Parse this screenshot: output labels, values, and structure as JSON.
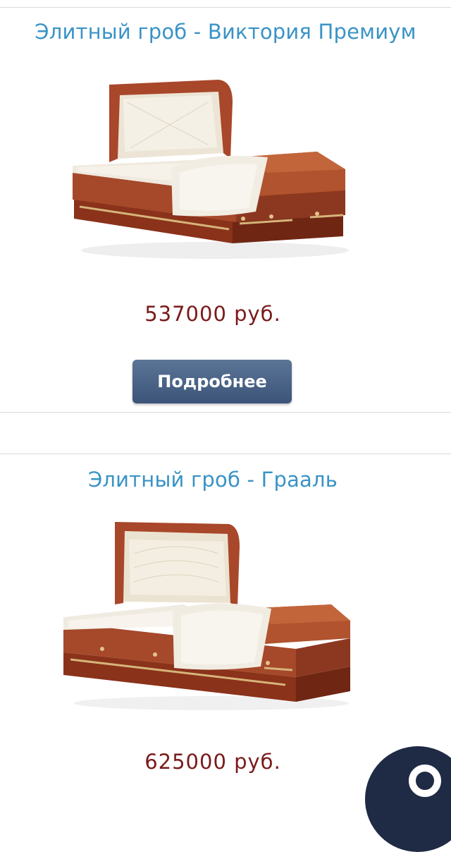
{
  "products": [
    {
      "title": "Элитный гроб - Виктория Премиум",
      "price": "537000 руб.",
      "details_label": "Подробнее"
    },
    {
      "title": "Элитный гроб - Грааль",
      "price": "625000 руб."
    }
  ],
  "colors": {
    "title": "#3a93c6",
    "price": "#7a1a1a",
    "button": "#4a6489",
    "wood": "#9c3f22",
    "satin": "#f1ece2"
  },
  "floating_button": {
    "icon": "circle-icon"
  }
}
